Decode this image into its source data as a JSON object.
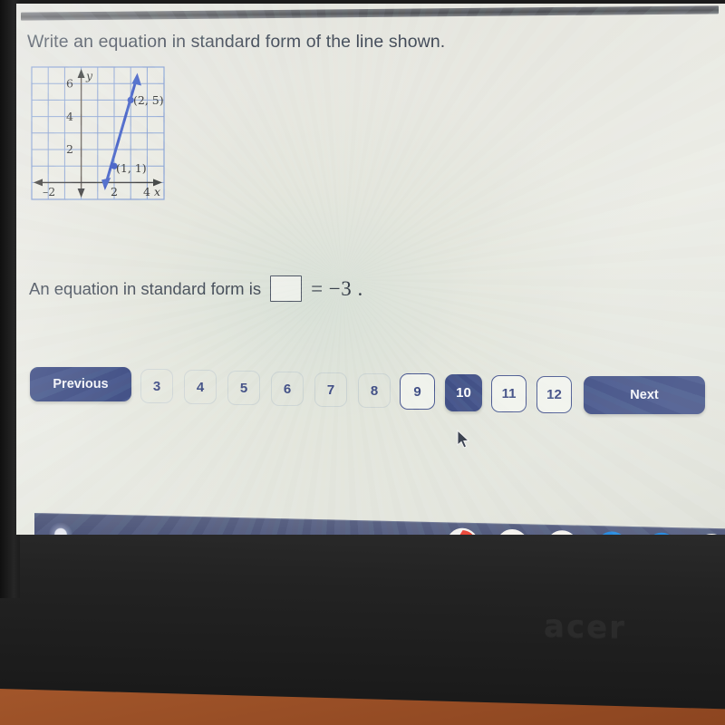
{
  "device": {
    "brand_logo": "acer",
    "platform": "chromeos"
  },
  "question": {
    "prompt": "Write an equation in standard form of the line shown.",
    "answer_sentence_prefix": "An equation in standard form is",
    "answer_input_value": "",
    "answer_input_placeholder": "",
    "answer_equation_tail": "= −3 ."
  },
  "graph": {
    "x_axis_label": "x",
    "y_axis_label": "y",
    "x_tick_labels": [
      "–2",
      "2",
      "4"
    ],
    "y_tick_labels": [
      "2",
      "4",
      "6"
    ],
    "point_labels": [
      "(1, 1)",
      "(2, 5)"
    ],
    "line_color": "#2f4ec0",
    "grid_color": "#6f8fcf"
  },
  "chart_data": {
    "type": "line",
    "title": "",
    "xlabel": "x",
    "ylabel": "y",
    "xlim": [
      -3,
      5
    ],
    "ylim": [
      -1,
      7
    ],
    "grid": true,
    "xticks": [
      -2,
      2,
      4
    ],
    "yticks": [
      2,
      4,
      6
    ],
    "series": [
      {
        "name": "line through (1,1) and (2,5)",
        "points": [
          [
            1,
            1
          ],
          [
            2,
            5
          ]
        ],
        "slope": 4,
        "intercept": -3,
        "color": "#2f4ec0",
        "arrows": "both"
      }
    ],
    "annotations": [
      {
        "text": "(1, 1)",
        "x": 1,
        "y": 1
      },
      {
        "text": "(2, 5)",
        "x": 2,
        "y": 5
      }
    ]
  },
  "pagination": {
    "previous_label": "Previous",
    "next_label": "Next",
    "current_page": "10",
    "pages": [
      "3",
      "4",
      "5",
      "6",
      "7",
      "8",
      "9",
      "10",
      "11",
      "12"
    ],
    "accent_color": "#3b4a82"
  },
  "shelf": {
    "launcher_name": "launcher",
    "apps": [
      {
        "name": "chrome",
        "label": "Chrome",
        "running": true
      },
      {
        "name": "gmail",
        "label": "Gmail",
        "running": false
      },
      {
        "name": "google-docs",
        "label": "Docs",
        "running": false
      },
      {
        "name": "files",
        "label": "Files",
        "running": false
      },
      {
        "name": "messages",
        "label": "Messages",
        "running": false
      },
      {
        "name": "play-store",
        "label": "Play Store",
        "running": false
      }
    ]
  }
}
